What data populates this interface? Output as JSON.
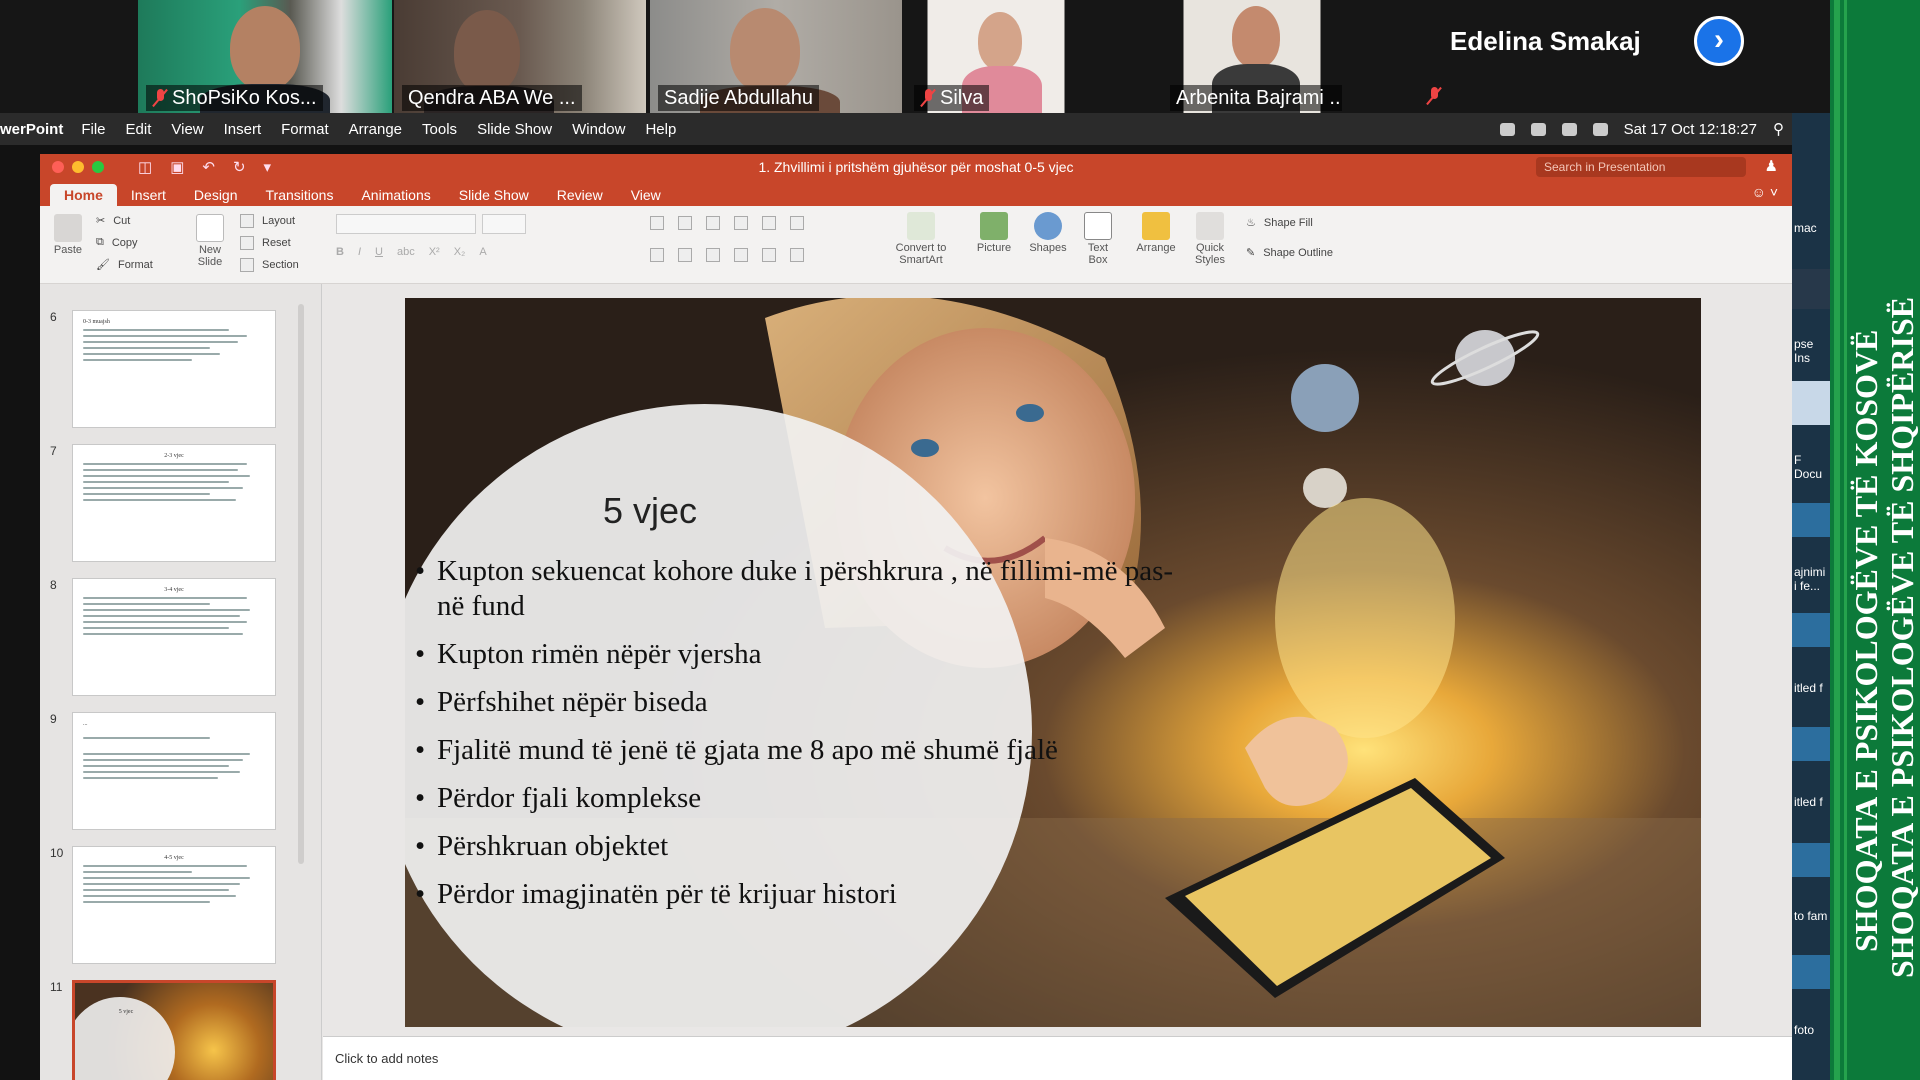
{
  "zoom": {
    "participants": [
      {
        "name": "ShoPsiKo Kos...",
        "muted": true
      },
      {
        "name": "Qendra ABA We ...",
        "muted": false
      },
      {
        "name": "Sadije Abdullahu",
        "muted": false
      },
      {
        "name": "Silva",
        "muted": true
      },
      {
        "name": "Arbenita Bajrami ...",
        "muted": false
      }
    ],
    "active_speaker": "Edelina Smakaj",
    "next_icon": "chevron-right-icon"
  },
  "menubar": {
    "app": "werPoint",
    "items": [
      "File",
      "Edit",
      "View",
      "Insert",
      "Format",
      "Arrange",
      "Tools",
      "Slide Show",
      "Window",
      "Help"
    ],
    "clock": "Sat 17 Oct  12:18:27"
  },
  "ppt": {
    "title": "1. Zhvillimi i pritshëm gjuhësor për moshat 0-5 vjec",
    "search_placeholder": "Search in Presentation",
    "tabs": [
      "Home",
      "Insert",
      "Design",
      "Transitions",
      "Animations",
      "Slide Show",
      "Review",
      "View"
    ],
    "ribbon": {
      "paste": "Paste",
      "cut": "Cut",
      "copy": "Copy",
      "format": "Format",
      "new_slide": "New Slide",
      "layout": "Layout",
      "reset": "Reset",
      "section": "Section",
      "convert": "Convert to SmartArt",
      "picture": "Picture",
      "shapes": "Shapes",
      "text_box": "Text Box",
      "arrange": "Arrange",
      "quick_styles": "Quick Styles",
      "shape_fill": "Shape Fill",
      "shape_outline": "Shape Outline"
    },
    "thumbnails": [
      {
        "num": "6",
        "title": "0-3 muajsh"
      },
      {
        "num": "7",
        "title": "2-3 vjec"
      },
      {
        "num": "8",
        "title": "3-4 vjec"
      },
      {
        "num": "9",
        "title": "..."
      },
      {
        "num": "10",
        "title": "4-5 vjec"
      },
      {
        "num": "11",
        "title": "5 vjec"
      }
    ],
    "notes_placeholder": "Click to add notes"
  },
  "slide": {
    "title": "5 vjec",
    "bullets": [
      "Kupton sekuencat kohore duke i përshkrura , në fillimi-më pas- në fund",
      "Kupton rimën nëpër vjersha",
      "Përfshihet nëpër biseda",
      "Fjalitë mund të jenë të gjata me 8 apo më shumë fjalë",
      " Përdor fjali komplekse",
      "Përshkruan objektet",
      "Përdor imagjinatën për të krijuar histori"
    ]
  },
  "right_panel": [
    "mac",
    "pse Ins",
    "F Docu",
    "ajnimi i fe...",
    "itled f",
    "itled f",
    "to fam",
    "foto"
  ],
  "watermark": {
    "line1": "SHOQATA E PSIKOLOGËVE TË KOSOVË",
    "line2": "SHOQATA E PSIKOLOGËVE TË SHQIPËRISË"
  },
  "colors": {
    "accent": "#c8462a",
    "zoom_blue": "#1a73e8",
    "green": "#0c7a3a"
  }
}
